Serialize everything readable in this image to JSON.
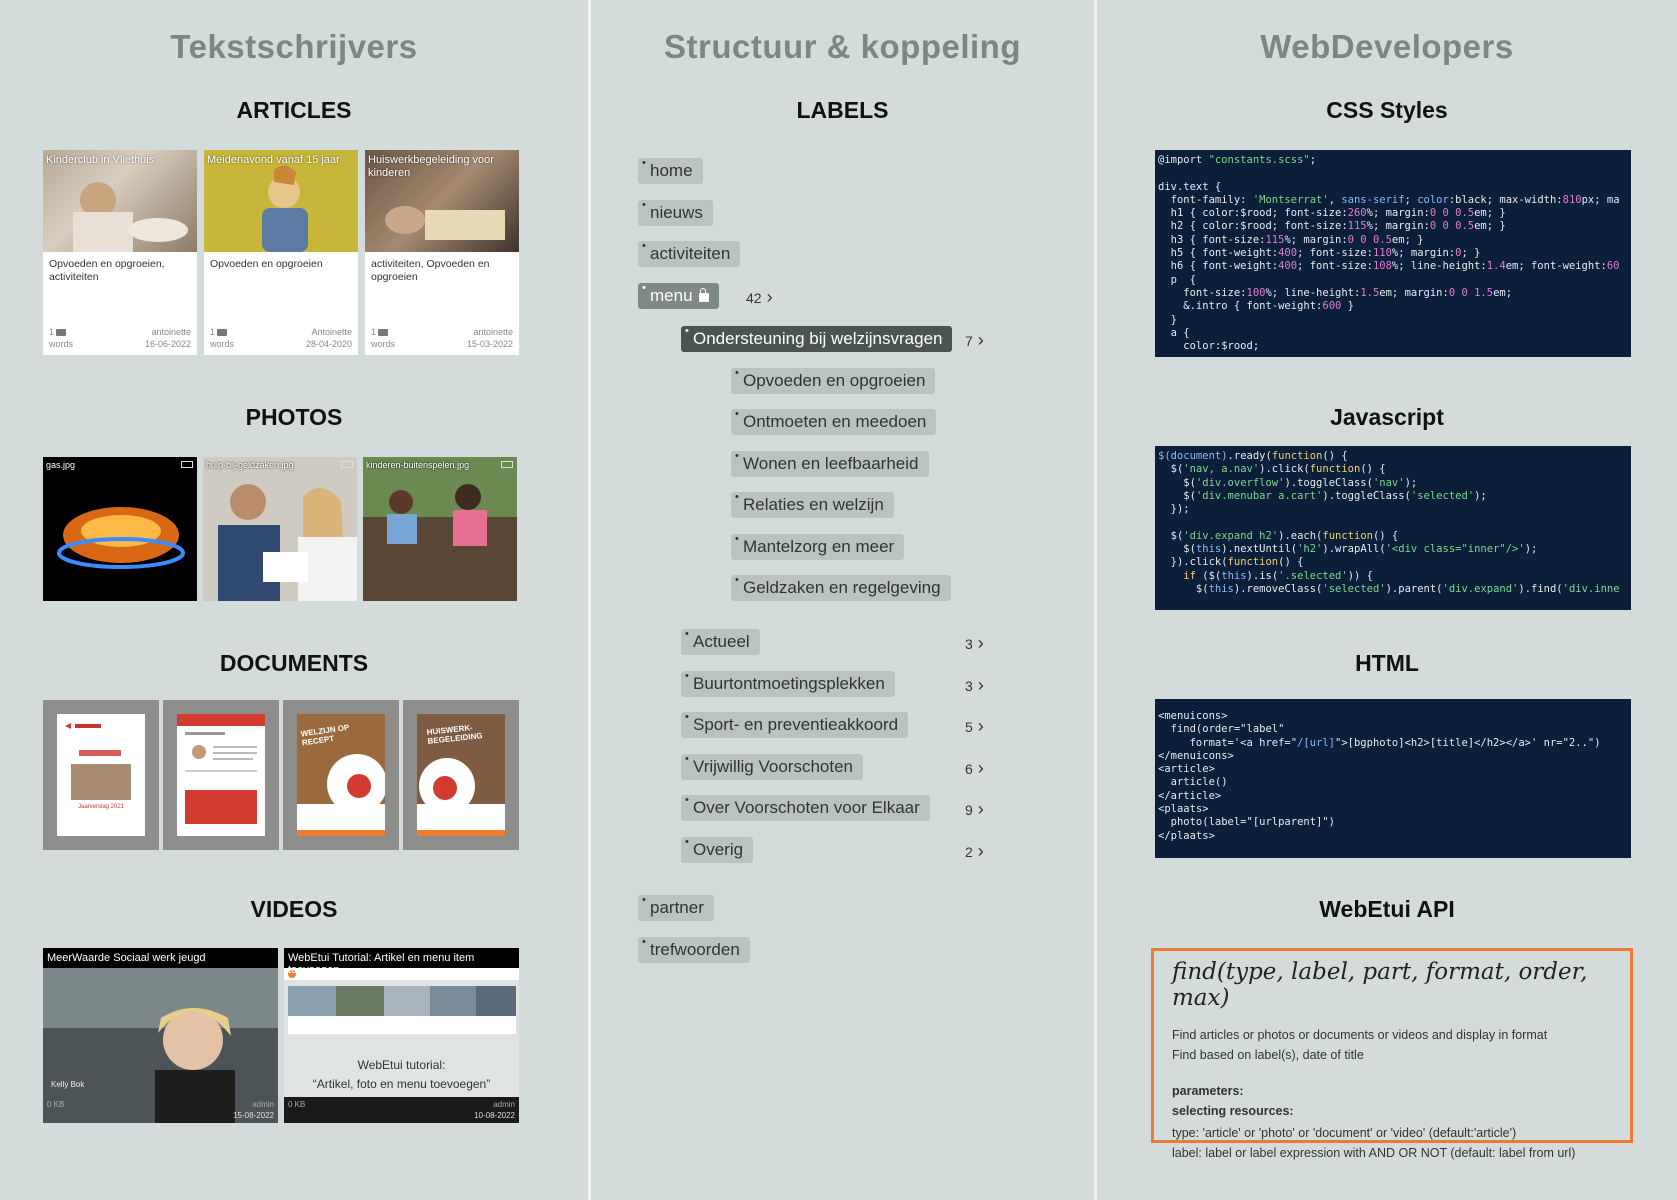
{
  "columns": {
    "writers": "Tekstschrijvers",
    "structure": "Structuur & koppeling",
    "developers": "WebDevelopers"
  },
  "sections": {
    "articles": "ARTICLES",
    "photos": "PHOTOS",
    "documents": "DOCUMENTS",
    "videos": "VIDEOS",
    "labels": "LABELS",
    "css": "CSS Styles",
    "javascript": "Javascript",
    "html": "HTML",
    "api": "WebEtui API"
  },
  "articles": [
    {
      "title": "Kinderclub in Vliethuis",
      "labels": "Opvoeden en opgroeien, activiteiten",
      "count": "1",
      "words": "words",
      "author": "antoinette",
      "date": "16-06-2022"
    },
    {
      "title": "Meidenavond vanaf 15 jaar",
      "labels": "Opvoeden en opgroeien",
      "count": "1",
      "words": "words",
      "author": "Antoinette",
      "date": "28-04-2020"
    },
    {
      "title": "Huiswerkbegeleiding voor kinderen",
      "labels": "activiteiten, Opvoeden en opgroeien",
      "count": "1",
      "words": "words",
      "author": "antoinette",
      "date": "15-03-2022"
    }
  ],
  "photos": [
    {
      "name": "gas.jpg"
    },
    {
      "name": "hulp-bij-geldzaken.jpg"
    },
    {
      "name": "kinderen-buitenspelen.jpg"
    }
  ],
  "documents": [
    {
      "text": "Jaarverslag 2021"
    },
    {
      "text": ""
    },
    {
      "text": "WELZIJN OP RECEPT"
    },
    {
      "text": "HUISWERK-BEGELEIDING"
    }
  ],
  "videos": [
    {
      "title": "MeerWaarde Sociaal werk jeugd",
      "caption": "",
      "size": "0 KB",
      "author": "admin",
      "date": "15-08-2022",
      "person": "Kelly Bok"
    },
    {
      "title": "WebEtui Tutorial: Artikel en menu item toevoegen",
      "caption": "WebEtui tutorial:",
      "caption2": "“Artikel, foto en menu toevoegen”",
      "size": "0 KB",
      "author": "admin",
      "date": "10-08-2022"
    }
  ],
  "labels": {
    "home": "home",
    "nieuws": "nieuws",
    "activiteiten": "activiteiten",
    "menu": "menu",
    "menu_count": "42",
    "level1": [
      {
        "label": "Ondersteuning bij welzijnsvragen",
        "count": "7"
      },
      {
        "label": "Actueel",
        "count": "3"
      },
      {
        "label": "Buurtontmoetingsplekken",
        "count": "3"
      },
      {
        "label": "Sport- en preventieakkoord",
        "count": "5"
      },
      {
        "label": "Vrijwillig Voorschoten",
        "count": "6"
      },
      {
        "label": "Over Voorschoten voor Elkaar",
        "count": "9"
      },
      {
        "label": "Overig",
        "count": "2"
      }
    ],
    "level2": [
      "Opvoeden en opgroeien",
      "Ontmoeten en meedoen",
      "Wonen en leefbaarheid",
      "Relaties en welzijn",
      "Mantelzorg en meer",
      "Geldzaken en regelgeving"
    ],
    "partner": "partner",
    "trefwoorden": "trefwoorden"
  },
  "api": {
    "signature": "find(type, label, part, format, order, max)",
    "line1": "Find articles or photos or documents or videos and display in format",
    "line2": "Find based on label(s), date of title",
    "params": "parameters:",
    "selecting": "selecting resources:",
    "type": "type: 'article' or 'photo' or 'document' or 'video' (default:'article')",
    "label": "label: label or label expression with AND OR NOT (default: label from url)"
  },
  "colors": {
    "background": "#d3dcdb",
    "code_bg": "#0b1e3a",
    "api_border": "#ee7a35",
    "tag": "#b9c3c1"
  }
}
